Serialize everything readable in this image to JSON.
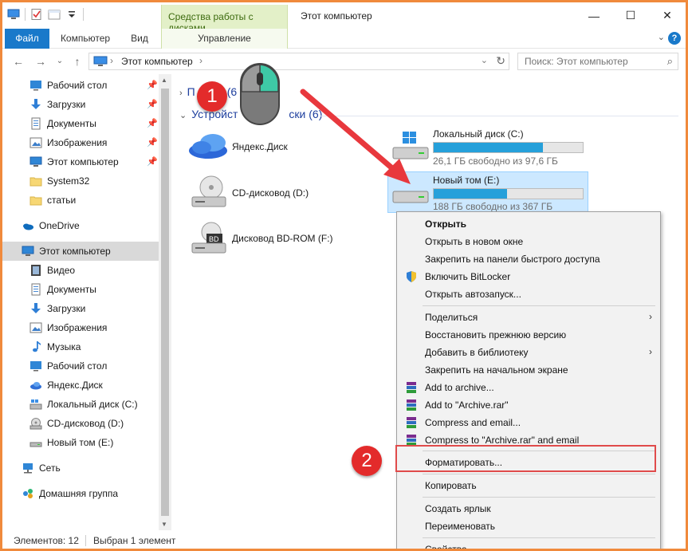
{
  "titlebar": {
    "contextual_tab": "Средства работы с дисками",
    "window_title": "Этот компьютер",
    "minimize": "—",
    "maximize": "☐",
    "close": "✕"
  },
  "ribbon": {
    "tabs": [
      "Файл",
      "Компьютер",
      "Вид",
      "Управление"
    ],
    "expand": "⌄",
    "help": "?"
  },
  "address": {
    "path": "Этот компьютер",
    "sep": "›",
    "dropdown": "⌄",
    "refresh": "↻"
  },
  "search": {
    "placeholder": "Поиск: Этот компьютер"
  },
  "sidebar": {
    "quick_access": [
      {
        "label": "Рабочий стол",
        "icon": "desktop-icon",
        "pinned": true
      },
      {
        "label": "Загрузки",
        "icon": "download-icon",
        "pinned": true
      },
      {
        "label": "Документы",
        "icon": "documents-icon",
        "pinned": true
      },
      {
        "label": "Изображения",
        "icon": "pictures-icon",
        "pinned": true
      },
      {
        "label": "Этот компьютер",
        "icon": "computer-icon",
        "pinned": true
      },
      {
        "label": "System32",
        "icon": "folder-icon",
        "pinned": false
      },
      {
        "label": "статьи",
        "icon": "folder-icon",
        "pinned": false
      }
    ],
    "onedrive": "OneDrive",
    "this_pc": "Этот компьютер",
    "this_pc_items": [
      {
        "label": "Видео",
        "icon": "video-icon"
      },
      {
        "label": "Документы",
        "icon": "documents-icon"
      },
      {
        "label": "Загрузки",
        "icon": "download-icon"
      },
      {
        "label": "Изображения",
        "icon": "pictures-icon"
      },
      {
        "label": "Музыка",
        "icon": "music-icon"
      },
      {
        "label": "Рабочий стол",
        "icon": "desktop-icon"
      },
      {
        "label": "Яндекс.Диск",
        "icon": "yandex-disk-icon"
      },
      {
        "label": "Локальный диск (C:)",
        "icon": "drive-icon"
      },
      {
        "label": "CD-дисковод (D:)",
        "icon": "cd-drive-icon"
      },
      {
        "label": "Новый том (E:)",
        "icon": "drive-icon"
      }
    ],
    "network": "Сеть",
    "homegroup": "Домашняя группа"
  },
  "content": {
    "group_folders": "Папки (6)",
    "group_folders_visible": "П",
    "group_folders_count": "(6",
    "group_devices_visible_left": "Устройст",
    "group_devices_visible_right": "ски (6)",
    "devices": [
      {
        "label": "Яндекс.Диск",
        "icon": "yandex-disk-icon"
      },
      {
        "label": "CD-дисковод (D:)",
        "icon": "cd-drive-icon"
      },
      {
        "label": "Дисковод BD-ROM (F:)",
        "icon": "bd-drive-icon"
      },
      {
        "label": "Локальный диск (C:)",
        "icon": "windows-drive-icon",
        "free": "26,1 ГБ свободно из 97,6 ГБ",
        "used_fraction": 0.73
      },
      {
        "label": "Новый том (E:)",
        "icon": "drive-icon",
        "free": "188 ГБ свободно из 367 ГБ",
        "used_fraction": 0.49,
        "selected": true
      }
    ]
  },
  "status": {
    "count": "Элементов: 12",
    "selection": "Выбран 1 элемент"
  },
  "context_menu": {
    "items": [
      {
        "label": "Открыть",
        "bold": true
      },
      {
        "label": "Открыть в новом окне"
      },
      {
        "label": "Закрепить на панели быстрого доступа"
      },
      {
        "label": "Включить BitLocker",
        "icon": "shield-icon"
      },
      {
        "label": "Открыть автозапуск..."
      },
      {
        "label": "Поделиться",
        "submenu": true
      },
      {
        "label": "Восстановить прежнюю версию"
      },
      {
        "label": "Добавить в библиотеку",
        "submenu": true
      },
      {
        "label": "Закрепить на начальном экране"
      },
      {
        "label": "Add to archive...",
        "icon": "winrar-icon"
      },
      {
        "label": "Add to \"Archive.rar\"",
        "icon": "winrar-icon"
      },
      {
        "label": "Compress and email...",
        "icon": "winrar-icon"
      },
      {
        "label": "Compress to \"Archive.rar\" and email",
        "icon": "winrar-icon"
      },
      {
        "label": "Форматировать..."
      },
      {
        "label": "Копировать"
      },
      {
        "label": "Создать ярлык"
      },
      {
        "label": "Переименовать"
      },
      {
        "label": "Свойства"
      }
    ]
  },
  "annotations": {
    "step1": "1",
    "step2": "2",
    "arrow_color": "#e8383d",
    "highlight_color": "#e04b4b"
  }
}
